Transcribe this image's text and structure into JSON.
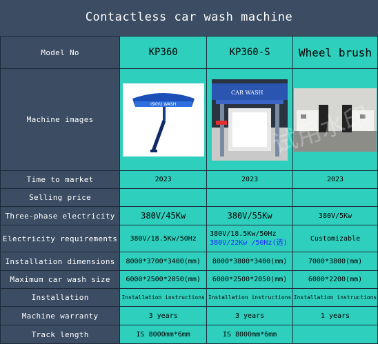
{
  "title": "Contactless car wash machine",
  "headers": {
    "label": "Model No",
    "col1": "KP360",
    "col2": "KP360-S",
    "col3": "Wheel brush"
  },
  "image_row_label": "Machine images",
  "rows": {
    "market": {
      "label": "Time to market",
      "c1": "2023",
      "c2": "2023",
      "c3": "2023"
    },
    "price": {
      "label": "Selling price",
      "c1": "",
      "c2": "",
      "c3": ""
    },
    "power": {
      "label": "Three-phase electricity",
      "c1": "380V/45Kw",
      "c2": "380V/55Kw",
      "c3": "380V/5Kw"
    },
    "elec": {
      "label": "Electricity requirements",
      "c1": "380V/18.5Kw/50Hz",
      "c2a": "380V/18.5Kw/50Hz",
      "c2b": "380V/22Kw /50Hz(选)",
      "c3": "Customizable"
    },
    "dims": {
      "label": "Installation dimensions",
      "c1": "8000*3700*3400(mm)",
      "c2": "8000*3800*3400(mm)",
      "c3": "7000*3800(mm)"
    },
    "maxsize": {
      "label": "Maximum car wash size",
      "c1": "6000*2500*2050(mm)",
      "c2": "6000*2500*2050(mm)",
      "c3": "6000*2200(mm)"
    },
    "install": {
      "label": "Installation",
      "c1": "Installation instructions",
      "c2": "Installation instructions",
      "c3": "Installation instructions"
    },
    "warranty": {
      "label": "Machine warranty",
      "c1": "3 years",
      "c2": "3 years",
      "c3": "1 years"
    },
    "track": {
      "label": "Track length",
      "c1": "IS 8000mm*6mm",
      "c2": "IS 8000mm*6mm",
      "c3": ""
    }
  },
  "images": {
    "c1": "ISKYU WASH",
    "c2": "CAR WASH"
  },
  "watermark": "试用水印",
  "colors": {
    "header_bg": "#3b4c63",
    "cell_bg": "#2fcfbd",
    "note_blue": "#1a2cff"
  }
}
